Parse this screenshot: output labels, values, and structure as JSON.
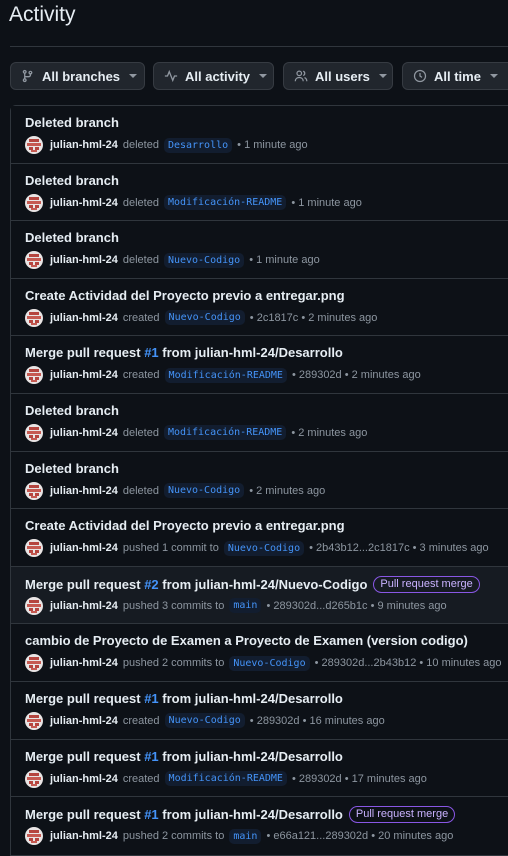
{
  "title": "Activity",
  "filters": [
    {
      "label": "All branches",
      "icon": "branch-icon"
    },
    {
      "label": "All activity",
      "icon": "pulse-icon"
    },
    {
      "label": "All users",
      "icon": "people-icon"
    },
    {
      "label": "All time",
      "icon": "clock-icon"
    }
  ],
  "rows": [
    {
      "title": "Deleted branch",
      "user": "julian-hml-24",
      "verb": "deleted",
      "branch": "Desarrollo",
      "time": "• 1 minute ago"
    },
    {
      "title": "Deleted branch",
      "user": "julian-hml-24",
      "verb": "deleted",
      "branch": "Modificación-README",
      "time": "• 1 minute ago"
    },
    {
      "title": "Deleted branch",
      "user": "julian-hml-24",
      "verb": "deleted",
      "branch": "Nuevo-Codigo",
      "time": "• 1 minute ago"
    },
    {
      "title": "Create Actividad del Proyecto previo a entregar.png",
      "user": "julian-hml-24",
      "verb": "created",
      "branch": "Nuevo-Codigo",
      "time": "• 2c1817c • 2 minutes ago"
    },
    {
      "title_pre": "Merge pull request ",
      "pr": "#1",
      "title_post": " from julian-hml-24/Desarrollo",
      "user": "julian-hml-24",
      "verb": "created",
      "branch": "Modificación-README",
      "time": "• 289302d • 2 minutes ago"
    },
    {
      "title": "Deleted branch",
      "user": "julian-hml-24",
      "verb": "deleted",
      "branch": "Modificación-README",
      "time": "• 2 minutes ago"
    },
    {
      "title": "Deleted branch",
      "user": "julian-hml-24",
      "verb": "deleted",
      "branch": "Nuevo-Codigo",
      "time": "• 2 minutes ago"
    },
    {
      "title": "Create Actividad del Proyecto previo a entregar.png",
      "user": "julian-hml-24",
      "verb": "pushed 1 commit to",
      "branch": "Nuevo-Codigo",
      "time": "• 2b43b12...2c1817c • 3 minutes ago"
    },
    {
      "title_pre": "Merge pull request ",
      "pr": "#2",
      "title_post": " from julian-hml-24/Nuevo-Codigo",
      "badge": "Pull request merge",
      "user": "julian-hml-24",
      "verb": "pushed 3 commits to",
      "branch": "main",
      "time": "• 289302d...d265b1c • 9 minutes ago",
      "highlight": true
    },
    {
      "title": "cambio de Proyecto de Examen a Proyecto de Examen (version codigo)",
      "user": "julian-hml-24",
      "verb": "pushed 2 commits to",
      "branch": "Nuevo-Codigo",
      "time": "• 289302d...2b43b12 • 10 minutes ago"
    },
    {
      "title_pre": "Merge pull request ",
      "pr": "#1",
      "title_post": " from julian-hml-24/Desarrollo",
      "user": "julian-hml-24",
      "verb": "created",
      "branch": "Nuevo-Codigo",
      "time": "• 289302d • 16 minutes ago"
    },
    {
      "title_pre": "Merge pull request ",
      "pr": "#1",
      "title_post": " from julian-hml-24/Desarrollo",
      "user": "julian-hml-24",
      "verb": "created",
      "branch": "Modificación-README",
      "time": "• 289302d • 17 minutes ago"
    },
    {
      "title_pre": "Merge pull request ",
      "pr": "#1",
      "title_post": " from julian-hml-24/Desarrollo",
      "badge": "Pull request merge",
      "user": "julian-hml-24",
      "verb": "pushed 2 commits to",
      "branch": "main",
      "time": "• e66a121...289302d • 20 minutes ago"
    }
  ],
  "colors": {
    "background": "#0d1117",
    "link": "#4493f8",
    "badge": "#8957e5"
  }
}
